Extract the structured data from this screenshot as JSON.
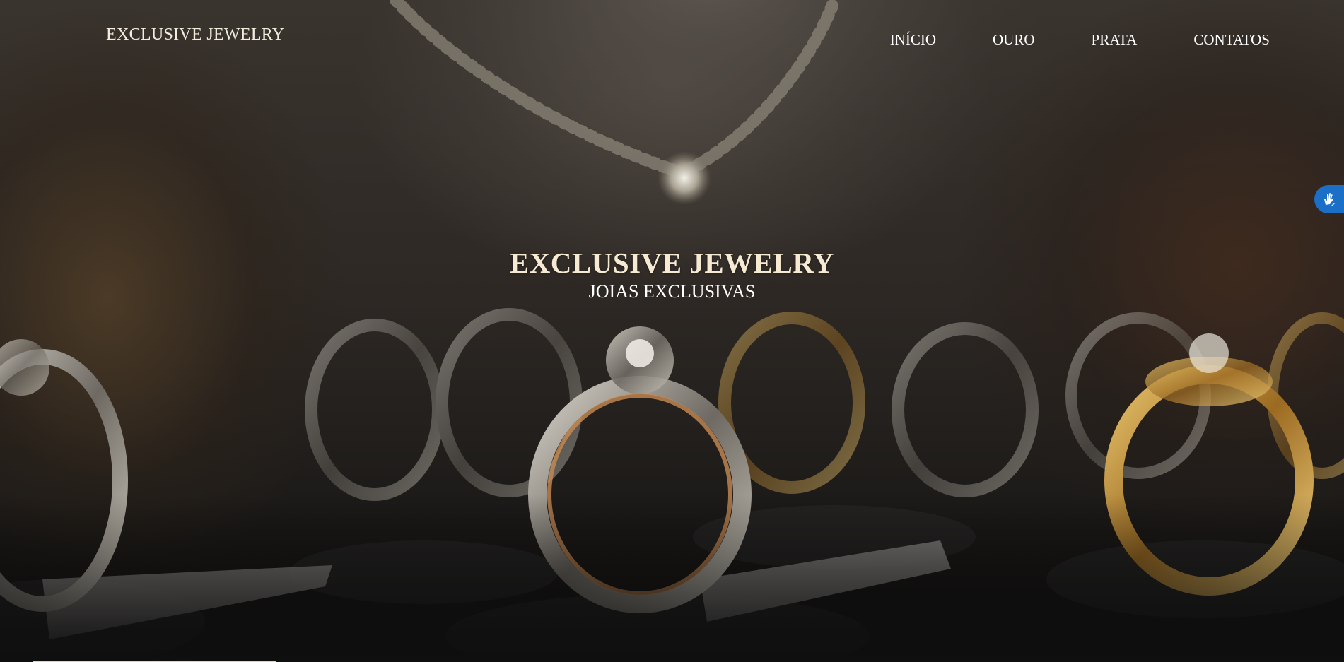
{
  "header": {
    "brand": "EXCLUSIVE JEWELRY",
    "nav": [
      "INÍCIO",
      "OURO",
      "PRATA",
      "CONTATOS"
    ]
  },
  "hero": {
    "title": "EXCLUSIVE JEWELRY",
    "subtitle": "JOIAS EXCLUSIVAS"
  },
  "accessibility": {
    "icon": "sign-language-hands-icon",
    "color": "#1c6fc7"
  },
  "colors": {
    "title": "#f6ead3",
    "nav_text": "#ffffff"
  }
}
